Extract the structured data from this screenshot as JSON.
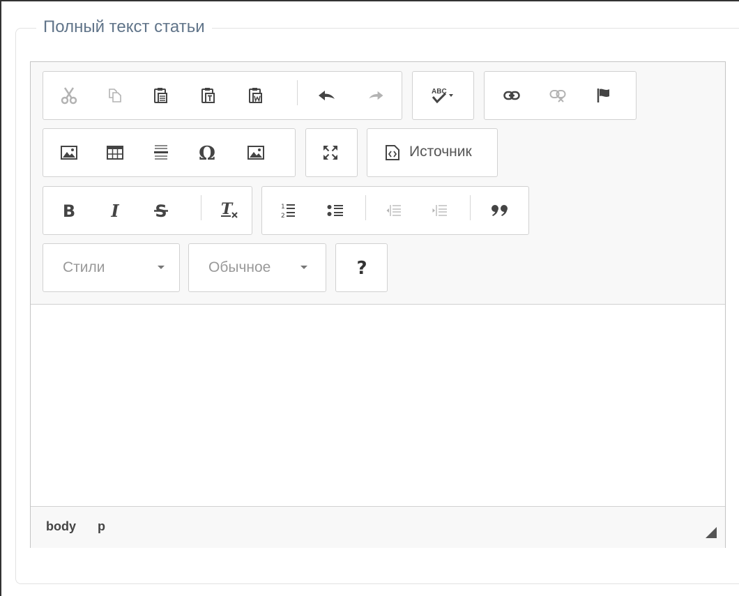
{
  "fieldset": {
    "legend": "Полный текст статьи"
  },
  "editor": {
    "toolbar": {
      "row1": {
        "clipboard": [
          "cut-icon",
          "copy-icon",
          "paste-icon",
          "paste-text-icon",
          "paste-word-icon"
        ],
        "history": [
          "undo-icon",
          "redo-icon"
        ],
        "spellcheck": [
          "spellcheck-icon"
        ],
        "links": [
          "link-icon",
          "unlink-icon",
          "anchor-flag-icon"
        ]
      },
      "row2": {
        "insert": [
          "image-icon",
          "table-icon",
          "horizontal-rule-icon",
          "special-char-icon",
          "image-alt-icon"
        ],
        "maximize": [
          "maximize-icon"
        ],
        "source_label": "Источник"
      },
      "row3": {
        "basicstyles": [
          "bold-icon",
          "italic-icon",
          "strike-icon",
          "remove-format-icon"
        ],
        "paragraph": [
          "numbered-list-icon",
          "bulleted-list-icon",
          "outdent-icon",
          "indent-icon",
          "blockquote-icon"
        ]
      },
      "row4": {
        "styles_label": "Стили",
        "format_label": "Обычное",
        "help_icon": "help-icon"
      }
    },
    "content": "",
    "statusbar": {
      "path": [
        "body",
        "p"
      ]
    }
  },
  "colors": {
    "legend_text": "#607489",
    "icon_dark": "#444444",
    "icon_disabled": "#b3b3b3",
    "border": "#d1d1d1",
    "toolbar_bg": "#f8f8f8"
  }
}
